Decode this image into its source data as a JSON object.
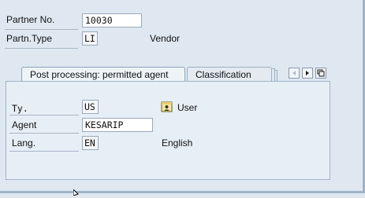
{
  "header": {
    "partner_no": {
      "label": "Partner No.",
      "value": "10030"
    },
    "partner_type": {
      "label": "Partn.Type",
      "value": "LI",
      "description": "Vendor"
    }
  },
  "tabs": [
    {
      "label": "Post processing: permitted agent",
      "active": true
    },
    {
      "label": "Classification",
      "active": false
    }
  ],
  "tab_nav": {
    "icons": [
      "scroll-left-icon",
      "scroll-right-icon",
      "tab-list-icon"
    ]
  },
  "agent_panel": {
    "type": {
      "label": "Ty.",
      "value": "US",
      "description": "User",
      "icon": "user-icon"
    },
    "agent": {
      "label": "Agent",
      "value": "KESARIP"
    },
    "language": {
      "label": "Lang.",
      "value": "EN",
      "description": "English"
    }
  },
  "colors": {
    "background": "#dfe8f1",
    "panel": "#e6eef6",
    "border": "#9fb3c6"
  }
}
